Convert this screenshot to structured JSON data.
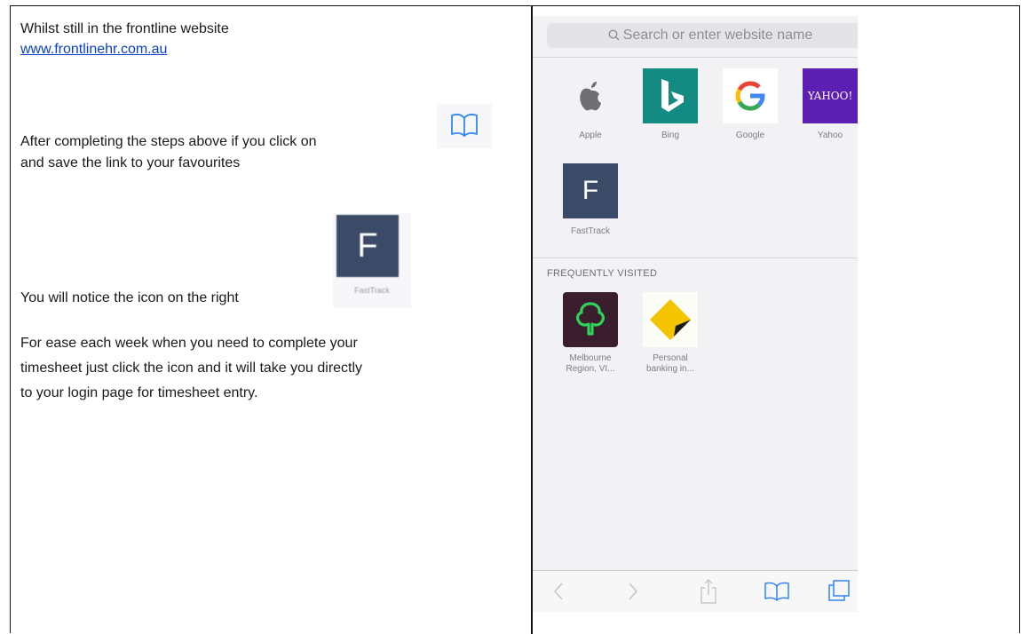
{
  "instructions": {
    "line1": "Whilst still in the frontline website",
    "link": "www.frontlinehr.com.au",
    "line2a": "After completing the steps above if you click on",
    "line2b": "and save the link to your favourites",
    "line3": "You will notice the icon on the right",
    "line4a": "For ease each week when you need to complete your",
    "line4b": "timesheet just click the icon and it will take you directly",
    "line4c": "to your login page for timesheet entry.",
    "inline_icon_letter": "F",
    "inline_icon_caption": "FastTrack",
    "inline_bookmark_icon": "book-icon"
  },
  "phone": {
    "search_placeholder": "Search or enter website name",
    "favorites": [
      {
        "label": "Apple",
        "icon": "apple-icon"
      },
      {
        "label": "Bing",
        "icon": "bing-icon",
        "color": "#138a82"
      },
      {
        "label": "Google",
        "icon": "google-icon"
      },
      {
        "label": "Yahoo",
        "icon": "yahoo-icon",
        "text": "YAHOO!",
        "color": "#5c1fb3"
      },
      {
        "label": "FastTrack",
        "icon": "fasttrack-icon",
        "text": "F",
        "color": "#3b4a66"
      }
    ],
    "frequently_visited_title": "FREQUENTLY VISITED",
    "frequent": [
      {
        "label_line1": "Melbourne",
        "label_line2": "Region, VI...",
        "icon": "tree-icon",
        "color": "#3a1e2e"
      },
      {
        "label_line1": "Personal",
        "label_line2": "banking in...",
        "icon": "commbank-icon",
        "color": "#f5c400"
      }
    ],
    "toolbar": [
      "back-icon",
      "forward-icon",
      "share-icon",
      "bookmarks-icon",
      "tabs-icon"
    ]
  }
}
